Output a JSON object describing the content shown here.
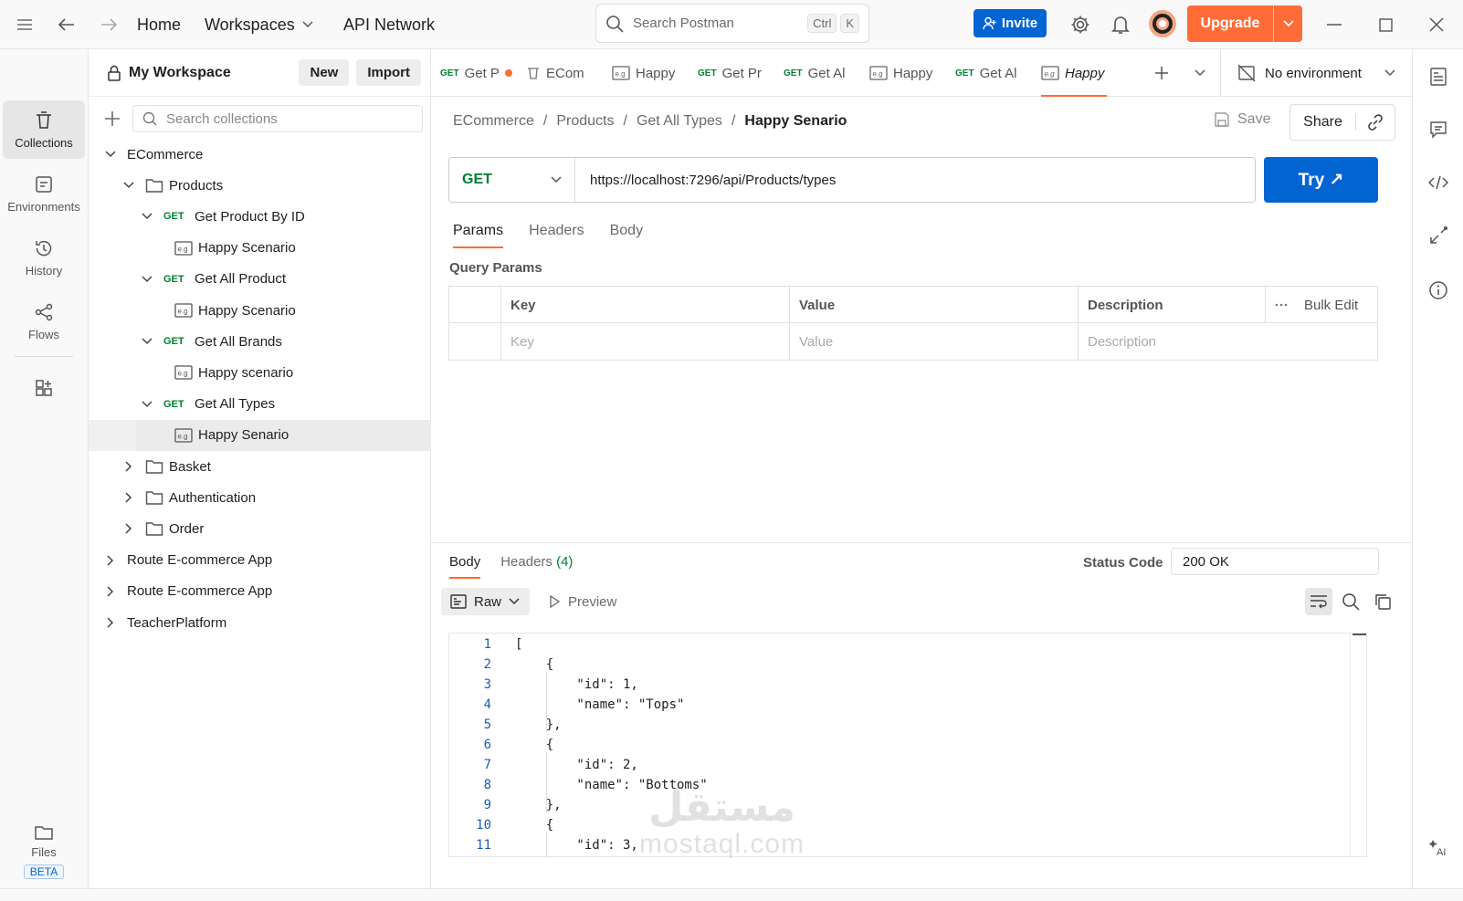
{
  "topbar": {
    "home": "Home",
    "workspaces": "Workspaces",
    "api_network": "API Network",
    "search_placeholder": "Search Postman",
    "kbd_ctrl": "Ctrl",
    "kbd_k": "K",
    "invite": "Invite",
    "upgrade": "Upgrade"
  },
  "rail": {
    "items": [
      {
        "label": "Collections",
        "icon": "trash-can-icon"
      },
      {
        "label": "Environments",
        "icon": "environment-icon"
      },
      {
        "label": "History",
        "icon": "history-icon"
      },
      {
        "label": "Flows",
        "icon": "flows-icon"
      }
    ],
    "files": "Files",
    "beta": "BETA"
  },
  "sidebar": {
    "title": "My Workspace",
    "new": "New",
    "import": "Import",
    "search_placeholder": "Search collections",
    "tree": [
      {
        "label": "ECommerce",
        "method": "",
        "type": "collection",
        "expanded": true,
        "level": 0
      },
      {
        "label": "Products",
        "method": "",
        "type": "folder",
        "expanded": true,
        "level": 1
      },
      {
        "label": "Get Product By ID",
        "method": "GET",
        "type": "request",
        "expanded": true,
        "level": 2
      },
      {
        "label": "Happy Scenario",
        "method": "",
        "type": "example",
        "level": 3
      },
      {
        "label": "Get All Product",
        "method": "GET",
        "type": "request",
        "expanded": true,
        "level": 2
      },
      {
        "label": "Happy Scenario",
        "method": "",
        "type": "example",
        "level": 3
      },
      {
        "label": "Get All Brands",
        "method": "GET",
        "type": "request",
        "expanded": true,
        "level": 2
      },
      {
        "label": "Happy scenario",
        "method": "",
        "type": "example",
        "level": 3
      },
      {
        "label": "Get All Types",
        "method": "GET",
        "type": "request",
        "expanded": true,
        "level": 2
      },
      {
        "label": "Happy Senario",
        "method": "",
        "type": "example",
        "level": 3,
        "selected": true
      },
      {
        "label": "Basket",
        "method": "",
        "type": "folder",
        "expanded": false,
        "level": 1
      },
      {
        "label": "Authentication",
        "method": "",
        "type": "folder",
        "expanded": false,
        "level": 1
      },
      {
        "label": "Order",
        "method": "",
        "type": "folder",
        "expanded": false,
        "level": 1
      },
      {
        "label": "Route E-commerce App",
        "method": "",
        "type": "collection",
        "expanded": false,
        "level": 0
      },
      {
        "label": "Route E-commerce App",
        "method": "",
        "type": "collection",
        "expanded": false,
        "level": 0
      },
      {
        "label": "TeacherPlatform",
        "method": "",
        "type": "collection",
        "expanded": false,
        "level": 0
      }
    ]
  },
  "tabs": [
    {
      "method": "GET",
      "label": "Get P",
      "kind": "request",
      "dirty": true
    },
    {
      "method": "",
      "label": "ECom",
      "kind": "collection"
    },
    {
      "method": "",
      "label": "Happy",
      "kind": "example"
    },
    {
      "method": "GET",
      "label": "Get Pr",
      "kind": "request"
    },
    {
      "method": "GET",
      "label": "Get Al",
      "kind": "request"
    },
    {
      "method": "",
      "label": "Happy",
      "kind": "example"
    },
    {
      "method": "GET",
      "label": "Get Al",
      "kind": "request"
    },
    {
      "method": "",
      "label": "Happy",
      "kind": "example",
      "active": true
    }
  ],
  "environment": "No environment",
  "breadcrumb": [
    "ECommerce",
    "Products",
    "Get All Types",
    "Happy Senario"
  ],
  "save": "Save",
  "share": "Share",
  "request": {
    "method": "GET",
    "url": "https://localhost:7296/api/Products/types",
    "try": "Try ↗"
  },
  "request_tabs": [
    "Params",
    "Headers",
    "Body"
  ],
  "query_params": {
    "title": "Query Params",
    "headers": [
      "Key",
      "Value",
      "Description"
    ],
    "bulk_edit": "Bulk Edit",
    "placeholders": [
      "Key",
      "Value",
      "Description"
    ]
  },
  "response": {
    "tabs": {
      "body": "Body",
      "headers": "Headers",
      "headers_count": "(4)"
    },
    "status_label": "Status Code",
    "status_value": "200 OK",
    "raw": "Raw",
    "preview": "Preview",
    "lines": [
      {
        "n": "1",
        "text": "["
      },
      {
        "n": "2",
        "text": "    {"
      },
      {
        "n": "3",
        "text": "        \"id\": 1,"
      },
      {
        "n": "4",
        "text": "        \"name\": \"Tops\""
      },
      {
        "n": "5",
        "text": "    },"
      },
      {
        "n": "6",
        "text": "    {"
      },
      {
        "n": "7",
        "text": "        \"id\": 2,"
      },
      {
        "n": "8",
        "text": "        \"name\": \"Bottoms\""
      },
      {
        "n": "9",
        "text": "    },"
      },
      {
        "n": "10",
        "text": "    {"
      },
      {
        "n": "11",
        "text": "        \"id\": 3,"
      }
    ]
  },
  "watermark": {
    "arabic": "مستقل",
    "latin": "mostaql.com"
  }
}
